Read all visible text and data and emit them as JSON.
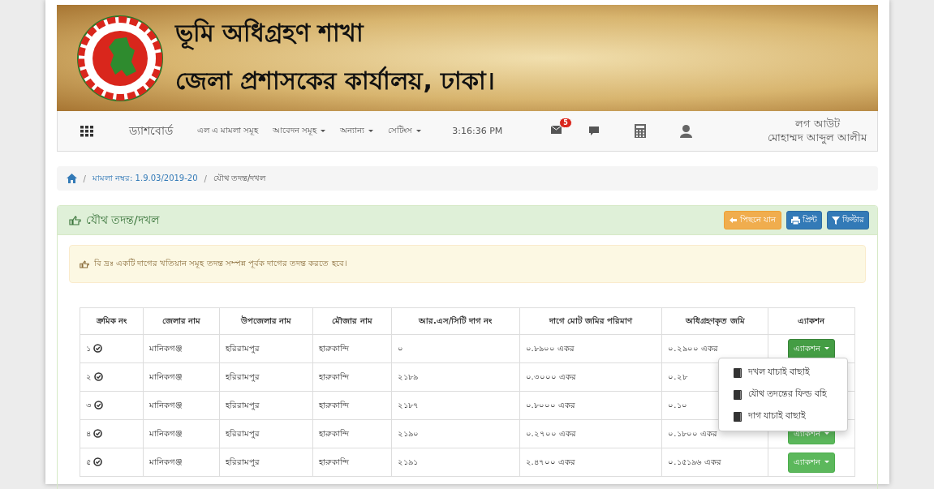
{
  "banner": {
    "title": "ভূমি অধিগ্রহণ শাখা",
    "subtitle": "জেলা প্রশাসকের কার্যালয়, ঢাকা।"
  },
  "navbar": {
    "brand": "ড্যাশবোর্ড",
    "items": [
      {
        "label": "এল এ মামলা সমূহ",
        "dropdown": false
      },
      {
        "label": "আবেদন সমূহ",
        "dropdown": true
      },
      {
        "label": "অন্যান্য",
        "dropdown": true
      },
      {
        "label": "সেটিংস",
        "dropdown": true
      }
    ],
    "time": "3:16:36 PM",
    "mail_badge": "5",
    "logout": "লগ আউট",
    "user": "মোহাম্মদ আব্দুল আলীম"
  },
  "breadcrumb_separator": "/",
  "breadcrumb": [
    {
      "label": "মামলা নম্বর: 1.9.03/2019-20",
      "link": true
    },
    {
      "label": "যৌথ তদন্ত/দখল",
      "link": false
    }
  ],
  "panel": {
    "title": "যৌথ তদন্ত/দখল",
    "buttons": [
      {
        "label": "পিছনে যান",
        "kind": "back"
      },
      {
        "label": "প্রিন্ট",
        "kind": "print"
      },
      {
        "label": "ফিল্টার",
        "kind": "filter"
      }
    ],
    "alert": "বি দ্রঃ একটি দাগের খতিয়ান সমূহ তদন্ত সম্পন্ন পূর্বক দাগের তদন্ত করতে হবে।"
  },
  "table": {
    "columns": [
      "ক্রমিক নং",
      "জেলার নাম",
      "উপজেলার নাম",
      "মৌজার নাম",
      "আর.এস/সিটি দাগ নং",
      "দাগে মোট জমির পরিমাণ",
      "অধিগ্রহণকৃত জমি",
      "এ্যাকশন"
    ],
    "rows": [
      {
        "serial": "১",
        "district": "মানিকগঞ্জ",
        "upazila": "হরিরামপুর",
        "mouza": "হারুকান্দি",
        "dag": "০",
        "total": "০.৮৯০০ একর",
        "acquired": "০.২৯০০ একর",
        "action": "এ্যাকশন",
        "open": true
      },
      {
        "serial": "২",
        "district": "মানিকগঞ্জ",
        "upazila": "হরিরামপুর",
        "mouza": "হারুকান্দি",
        "dag": "২১৮৯",
        "total": "০.৩০০০ একর",
        "acquired": "০.২৮",
        "action": "",
        "open": false
      },
      {
        "serial": "৩",
        "district": "মানিকগঞ্জ",
        "upazila": "হরিরামপুর",
        "mouza": "হারুকান্দি",
        "dag": "২১৮৭",
        "total": "০.৮০০০ একর",
        "acquired": "০.১০",
        "action": "",
        "open": false
      },
      {
        "serial": "৪",
        "district": "মানিকগঞ্জ",
        "upazila": "হরিরামপুর",
        "mouza": "হারুকান্দি",
        "dag": "২১৯০",
        "total": "০.২৭০০ একর",
        "acquired": "০.১৮০০ একর",
        "action": "এ্যাকশন",
        "open": false
      },
      {
        "serial": "৫",
        "district": "মানিকগঞ্জ",
        "upazila": "হরিরামপুর",
        "mouza": "হারুকান্দি",
        "dag": "২১৯১",
        "total": "২.৪৭০০ একর",
        "acquired": "০.১৫১৯৬ একর",
        "action": "এ্যাকশন",
        "open": false
      }
    ],
    "menu": [
      "দখল যাচাই বাছাই",
      "যৌথ তদন্তের ফিল্ড বহি",
      "দাগ যাচাই বাছাই"
    ]
  }
}
